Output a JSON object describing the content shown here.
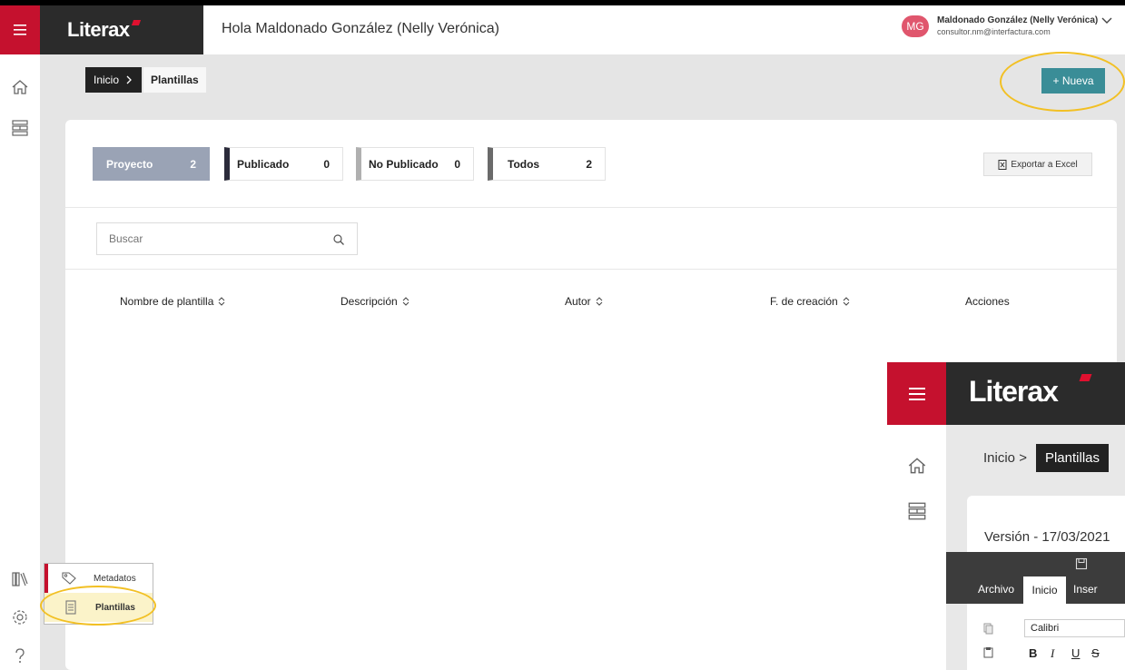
{
  "app": {
    "logo": "Literax",
    "greeting": "Hola Maldonado González (Nelly Verónica)",
    "user": {
      "initials": "MG",
      "name": "Maldonado González (Nelly Verónica)",
      "email": "consultor.nm@interfactura.com",
      "avatar_color": "#e0566d"
    },
    "brand_color": "#c5112e"
  },
  "breadcrumb": {
    "root": "Inicio",
    "current": "Plantillas"
  },
  "actions": {
    "new_label": "+ Nueva",
    "export_label": "Exportar a Excel"
  },
  "filters": [
    {
      "label": "Proyecto",
      "count": "2",
      "active": true
    },
    {
      "label": "Publicado",
      "count": "0",
      "active": false
    },
    {
      "label": "No Publicado",
      "count": "0",
      "active": false
    },
    {
      "label": "Todos",
      "count": "2",
      "active": false
    }
  ],
  "search": {
    "placeholder": "Buscar"
  },
  "table": {
    "columns": [
      "Nombre de plantilla",
      "Descripción",
      "Autor",
      "F. de creación",
      "Acciones"
    ]
  },
  "flyout_menu": {
    "items": [
      "Metadatos",
      "Plantillas"
    ]
  },
  "inset": {
    "logo": "Literax",
    "crumb_root": "Inicio",
    "crumb_current": "Plantillas",
    "version_text": "Versión - 17/03/2021",
    "ribbon_tabs": [
      "Archivo",
      "Inicio",
      "Inser"
    ],
    "font_name": "Calibri",
    "format_buttons": [
      "B",
      "I",
      "U",
      "S"
    ]
  }
}
